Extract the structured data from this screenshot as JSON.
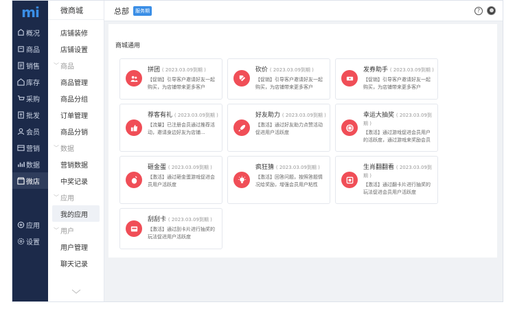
{
  "nav": {
    "logo": "mi",
    "items": [
      {
        "label": "概况",
        "icon": "overview-icon"
      },
      {
        "label": "商品",
        "icon": "goods-icon"
      },
      {
        "label": "销售",
        "icon": "sales-icon"
      },
      {
        "label": "库存",
        "icon": "stock-icon"
      },
      {
        "label": "采购",
        "icon": "purchase-icon"
      },
      {
        "label": "批发",
        "icon": "wholesale-icon"
      },
      {
        "label": "会员",
        "icon": "member-icon"
      },
      {
        "label": "营销",
        "icon": "marketing-icon"
      },
      {
        "label": "数据",
        "icon": "data-icon"
      },
      {
        "label": "微店",
        "icon": "shop-icon"
      }
    ],
    "bottom": [
      {
        "label": "应用",
        "icon": "apps-icon"
      },
      {
        "label": "设置",
        "icon": "settings-icon"
      }
    ]
  },
  "subnav": {
    "title": "微商城",
    "items": [
      "店铺装修",
      "店铺设置"
    ],
    "groups": [
      {
        "label": "商品",
        "items": [
          "商品管理",
          "商品分组",
          "订单管理",
          "商品分销"
        ]
      },
      {
        "label": "数据",
        "items": [
          "营销数据",
          "中奖记录"
        ]
      },
      {
        "label": "应用",
        "items": [
          "我的应用"
        ]
      },
      {
        "label": "用户",
        "items": [
          "用户管理",
          "聊天记录"
        ]
      }
    ]
  },
  "header": {
    "store": "总部",
    "badge": "服务期",
    "help": "?"
  },
  "main": {
    "section_title": "商城通用",
    "cards": [
      {
        "title": "拼团",
        "date": "( 2023.03.09到期 )",
        "desc": "【促销】引导客户邀请好友一起购买，为店铺带来更多客户",
        "icon": "group-buy-icon"
      },
      {
        "title": "砍价",
        "date": "( 2023.03.09到期 )",
        "desc": "【促销】引导客户邀请好友一起购买，为店铺带来更多客户",
        "icon": "bargain-icon"
      },
      {
        "title": "发券助手",
        "date": "( 2023.03.09到期 )",
        "desc": "【促销】引导客户邀请好友一起购买，为店铺带来更多客户",
        "icon": "coupon-icon"
      },
      {
        "title": "荐客有礼",
        "date": "( 2023.03.09到期 )",
        "desc": "【流量】已注册会员通过推荐活动，邀请身边好友为店铺...",
        "icon": "referral-icon"
      },
      {
        "title": "好友助力",
        "date": "( 2023.03.09到期 )",
        "desc": "【激活】通过好友助力点赞活动促进用户活跃度",
        "icon": "rocket-icon"
      },
      {
        "title": "幸运大抽奖",
        "date": "( 2023.03.09到期 )",
        "desc": "【激活】通过游戏促进会员用户的活跃度，通过游戏来奖励会员",
        "icon": "lottery-icon"
      },
      {
        "title": "砸金蛋",
        "date": "( 2023.03.09到期 )",
        "desc": "【激活】通过砸金蛋游戏促进会员用户活跃度",
        "icon": "egg-icon"
      },
      {
        "title": "疯狂猜",
        "date": "( 2023.03.09到期 )",
        "desc": "【激活】回答问题，按照答题情况给奖励，增强会员用户粘性",
        "icon": "guess-icon"
      },
      {
        "title": "生肖翻翻看",
        "date": "( 2023.03.09到期 )",
        "desc": "【激活】通过翻卡片进行抽奖的玩法促进会员用户活跃度",
        "icon": "zodiac-icon"
      },
      {
        "title": "刮刮卡",
        "date": "( 2023.03.09到期 )",
        "desc": "【激活】通过刮卡片进行抽奖的玩法促进用户活跃度",
        "icon": "scratch-card-icon"
      }
    ]
  },
  "colors": {
    "nav_bg": "#1c2a4a",
    "accent": "#3a8ee6",
    "card_icon": "#f04e57"
  }
}
